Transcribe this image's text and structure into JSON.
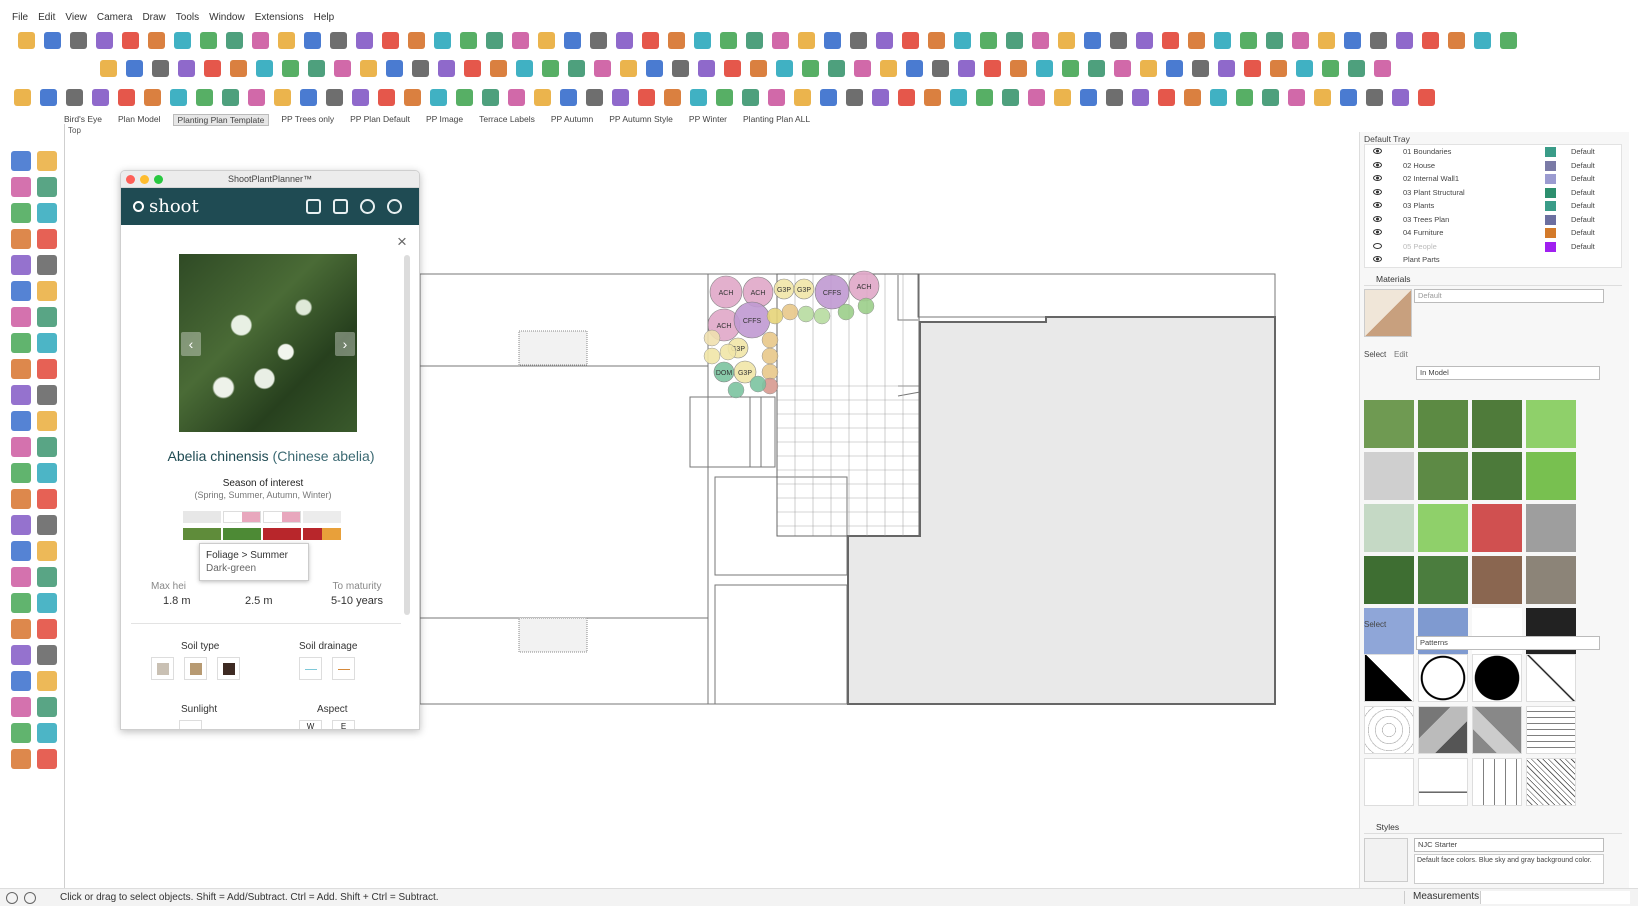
{
  "menu": [
    "File",
    "Edit",
    "View",
    "Camera",
    "Draw",
    "Tools",
    "Window",
    "Extensions",
    "Help"
  ],
  "scene_tabs": [
    "Bird's Eye",
    "Plan Model",
    "Planting Plan Template",
    "PP Trees only",
    "PP Plan Default",
    "PP Image",
    "Terrace Labels",
    "PP Autumn",
    "PP Autumn Style",
    "PP Winter",
    "Planting Plan ALL"
  ],
  "active_scene": "Planting Plan Template",
  "viewport_label": "Top",
  "status_text": "Click or drag to select objects. Shift = Add/Subtract. Ctrl = Add. Shift + Ctrl = Subtract.",
  "measurements_label": "Measurements",
  "plugin": {
    "title": "ShootPlantPlanner™",
    "logo": "shoot",
    "plant_latin": "Abelia chinensis",
    "plant_common": "(Chinese abelia)",
    "season_heading": "Season of interest",
    "season_list": "(Spring, Summer, Autumn, Winter)",
    "tooltip_line1": "Foliage > Summer",
    "tooltip_line2": "Dark-green",
    "max_height_label": "Max hei",
    "max_height_value": "1.8 m",
    "spread_value": "2.5 m",
    "maturity_label": "To maturity",
    "maturity_value": "5-10 years",
    "soil_type_label": "Soil type",
    "soil_drainage_label": "Soil drainage",
    "sunlight_label": "Sunlight",
    "aspect_label": "Aspect",
    "aspect_values": [
      "W",
      "E"
    ],
    "colors": {
      "header": "#1f4b53",
      "soil1": "#c9c0b3",
      "soil2": "#b79a72",
      "soil3": "#3d2a22"
    }
  },
  "tray": {
    "title": "Default Tray",
    "layers": [
      {
        "name": "01 Boundaries",
        "tag": "Default",
        "color": "#3a9c88",
        "visible": true
      },
      {
        "name": "02 House",
        "tag": "Default",
        "color": "#7a7aa6",
        "visible": true
      },
      {
        "name": "02 Internal Wall1",
        "tag": "Default",
        "color": "#9b9bd0",
        "visible": true
      },
      {
        "name": "03 Plant Structural",
        "tag": "Default",
        "color": "#2d8f6e",
        "visible": true
      },
      {
        "name": "03 Plants",
        "tag": "Default",
        "color": "#3a9c88",
        "visible": true
      },
      {
        "name": "03 Trees Plan",
        "tag": "Default",
        "color": "#6c6fa0",
        "visible": true
      },
      {
        "name": "04 Furniture",
        "tag": "Default",
        "color": "#d37a2a",
        "visible": true
      },
      {
        "name": "05 People",
        "tag": "Default",
        "color": "#a020f0",
        "visible": false
      },
      {
        "name": "Plant Parts",
        "tag": "",
        "color": "",
        "visible": true
      }
    ],
    "materials_label": "Materials",
    "material_name": "Default",
    "select_tab": "Select",
    "edit_tab": "Edit",
    "in_model": "In Model",
    "select_label": "Select",
    "patterns": "Patterns",
    "styles_label": "Styles",
    "style_name": "NJC Starter",
    "style_desc": "Default face colors. Blue sky and gray background color."
  },
  "plants": [
    {
      "label": "ACH",
      "color": "#e0a8c8"
    },
    {
      "label": "ACH",
      "color": "#e0a8c8"
    },
    {
      "label": "G3P",
      "color": "#f1e6a8"
    },
    {
      "label": "G3P",
      "color": "#f1e6a8"
    },
    {
      "label": "CFFS",
      "color": "#c09ad2"
    },
    {
      "label": "ACH",
      "color": "#e0a8c8"
    },
    {
      "label": "CFFS",
      "color": "#c09ad2"
    },
    {
      "label": "ACH",
      "color": "#e0a8c8"
    },
    {
      "label": "G3P",
      "color": "#f1e6a8"
    },
    {
      "label": "G3P",
      "color": "#f1e6a8"
    },
    {
      "label": "DOM",
      "color": "#7cc4a0"
    }
  ]
}
